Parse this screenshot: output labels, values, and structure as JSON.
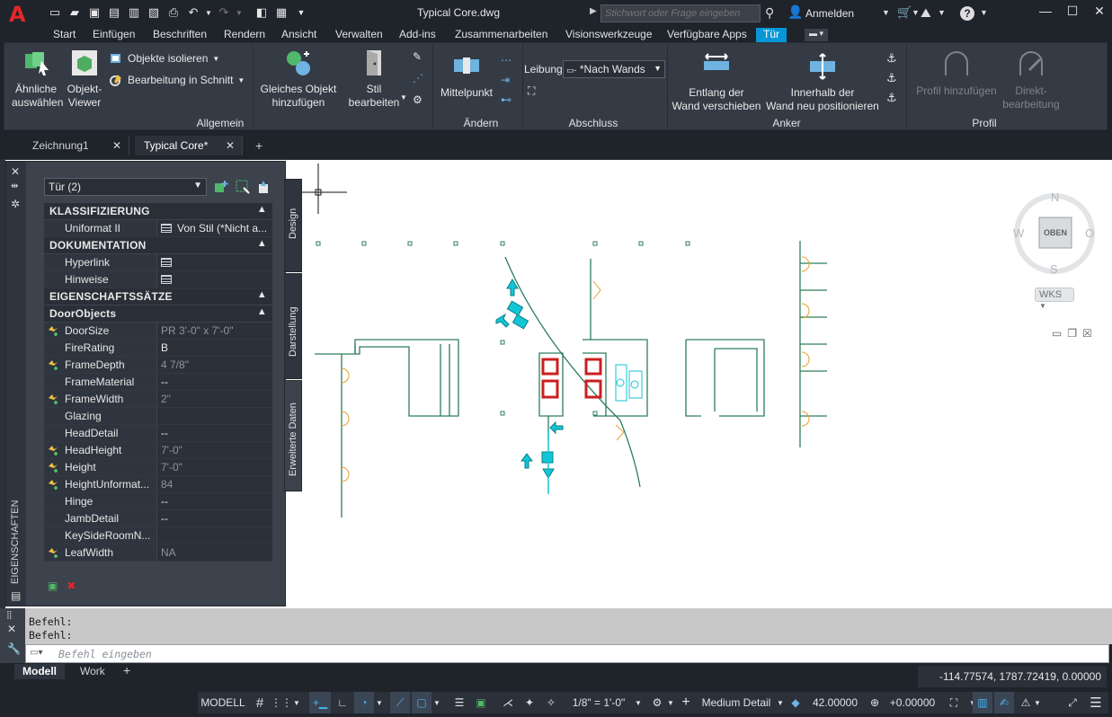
{
  "app": {
    "logo": "A",
    "doc_title": "Typical Core.dwg"
  },
  "search": {
    "placeholder": "Stichwort oder Frage eingeben"
  },
  "account": {
    "signin_label": "Anmelden"
  },
  "ribbon_tabs": [
    "Start",
    "Einfügen",
    "Beschriften",
    "Rendern",
    "Ansicht",
    "Verwalten",
    "Add-ins",
    "Zusammenarbeiten",
    "Visionswerkzeuge",
    "Verfügbare Apps",
    "Tür"
  ],
  "ribbon_active_tab": "Tür",
  "ribbon": {
    "allgemein": {
      "title": "Allgemein",
      "select_similar": "Ähnliche\nauswählen",
      "object_viewer": "Objekt-\nViewer",
      "isolate": "Objekte isolieren",
      "edit_in_section": "Bearbeitung in Schnitt",
      "add_same": "Gleiches Objekt\nhinzufügen",
      "edit_style": "Stil\nbearbeiten"
    },
    "aendern": {
      "title": "Ändern",
      "midpoint": "Mittelpunkt"
    },
    "abschluss": {
      "title": "Abschluss",
      "label": "Leibung",
      "value": "*Nach Wands"
    },
    "anker": {
      "title": "Anker",
      "slide_along": "Entlang der\nWand verschieben",
      "reposition_within": "Innerhalb der\nWand neu positionieren"
    },
    "profil": {
      "title": "Profil",
      "add_profile": "Profil hinzufügen",
      "direct_edit": "Direkt-\nbearbeitung"
    }
  },
  "file_tabs": [
    {
      "label": "Zeichnung1",
      "active": false
    },
    {
      "label": "Typical Core*",
      "active": true
    }
  ],
  "properties": {
    "palette_title": "EIGENSCHAFTEN",
    "selection": "Tür (2)",
    "side_tabs": [
      "Design",
      "Darstellung",
      "Erweiterte Daten"
    ],
    "categories": [
      {
        "name": "KLASSIFIZIERUNG",
        "rows": [
          {
            "name": "Uniformat II",
            "value": "Von Stil (*Nicht a...",
            "table_icon": true
          }
        ]
      },
      {
        "name": "DOKUMENTATION",
        "rows": [
          {
            "name": "Hyperlink",
            "value": "",
            "table_icon": true
          },
          {
            "name": "Hinweise",
            "value": "",
            "table_icon": true
          }
        ]
      },
      {
        "name": "EIGENSCHAFTSSÄTZE",
        "rows": []
      },
      {
        "name": "DoorObjects",
        "rows": [
          {
            "name": "DoorSize",
            "value": "PR 3'-0\" x 7'-0\"",
            "grey": true,
            "pin": true
          },
          {
            "name": "FireRating",
            "value": "B"
          },
          {
            "name": "FrameDepth",
            "value": "4 7/8\"",
            "grey": true,
            "pin": true
          },
          {
            "name": "FrameMaterial",
            "value": "--"
          },
          {
            "name": "FrameWidth",
            "value": "2\"",
            "grey": true,
            "pin": true
          },
          {
            "name": "Glazing",
            "value": ""
          },
          {
            "name": "HeadDetail",
            "value": "--"
          },
          {
            "name": "HeadHeight",
            "value": "7'-0\"",
            "grey": true,
            "pin": true
          },
          {
            "name": "Height",
            "value": "7'-0\"",
            "grey": true,
            "pin": true
          },
          {
            "name": "HeightUnformat...",
            "value": "84",
            "grey": true,
            "pin": true
          },
          {
            "name": "Hinge",
            "value": "--"
          },
          {
            "name": "JambDetail",
            "value": "--"
          },
          {
            "name": "KeySideRoomN...",
            "value": ""
          },
          {
            "name": "LeafWidth",
            "value": "NA",
            "grey": true,
            "pin": true
          }
        ]
      }
    ]
  },
  "viewcube": {
    "north": "N",
    "south": "S",
    "east": "O",
    "west": "W",
    "face": "OBEN",
    "ucs": "WKS"
  },
  "command": {
    "history": [
      "Befehl:",
      "Befehl:"
    ],
    "placeholder": "Befehl eingeben"
  },
  "layout_tabs": [
    "Modell",
    "Work"
  ],
  "coordinates": "-114.77574, 1787.72419, 0.00000",
  "status": {
    "model": "MODELL",
    "scale": "1/8\" = 1'-0\"",
    "detail": "Medium Detail",
    "elevation": "42.00000",
    "offset": "+0.00000"
  },
  "colors": {
    "accent": "#0696d7",
    "wall": "#2e7d5b",
    "door": "#12c6d6",
    "column": "#cc1f1f"
  }
}
